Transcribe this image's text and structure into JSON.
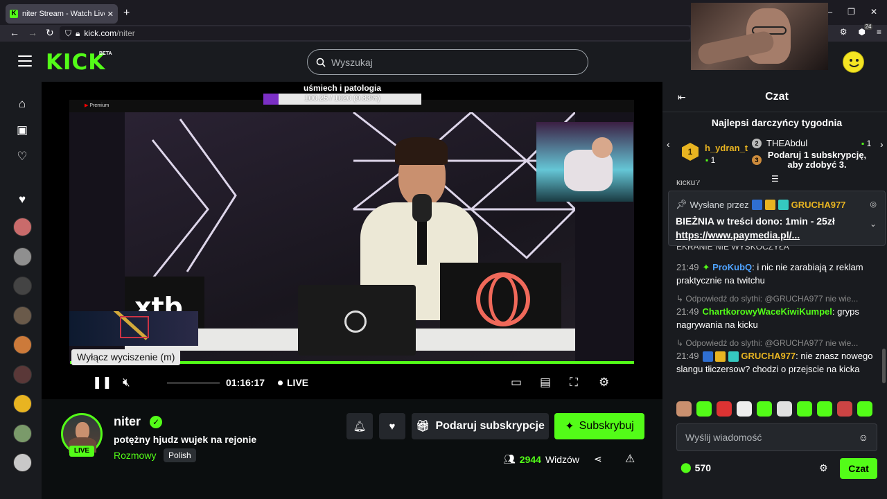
{
  "browser": {
    "tab_title": "niter Stream - Watch Live on Ki",
    "tab_close": "✕",
    "new_tab": "+",
    "url_host": "kick.com",
    "url_path": "/niter",
    "ext_badge": "24"
  },
  "header": {
    "logo": "KICK",
    "beta": "BETA",
    "search_placeholder": "Wyszukaj"
  },
  "sidebar": {
    "nav": [
      "home-icon",
      "following-icon",
      "heart-icon"
    ],
    "avatars": [
      "#c96b6b",
      "#8f8f8f",
      "#444",
      "#6a5a4a",
      "#cc7a3a",
      "#5a3838",
      "#e8b421",
      "#7a9a6a",
      "#c8c8c8"
    ]
  },
  "player": {
    "overlay_title": "uśmiech i patologia",
    "overlay_progress_text": "100.25 / 1020 (9.83%)",
    "overlay_progress_pct": 9.83,
    "yt_label": "Premium",
    "xtb": "xtb",
    "progress_pct": 100,
    "time": "01:16:17",
    "live_label": "LIVE",
    "tooltip": "Wyłącz wyciszenie (m)"
  },
  "channel": {
    "name": "niter",
    "live_badge": "LIVE",
    "title": "potężny hjudz wujek na rejonie",
    "category": "Rozmowy",
    "language_tag": "Polish",
    "gift_label": "Podaruj subskrypcje",
    "subscribe_label": "Subskrybuj",
    "viewers": "2944",
    "viewers_label": "Widzów"
  },
  "chat": {
    "title": "Czat",
    "gifters_title": "Najlepsi darczyńcy tygodnia",
    "gifter1": {
      "rank": "1",
      "name": "h_ydran_t",
      "count": "1"
    },
    "gifter2": {
      "rank": "2",
      "name": "THEAbdul",
      "count": "1"
    },
    "gifter3": {
      "rank": "3",
      "text": "Podaruj 1 subskrypcję, aby zdobyć 3."
    },
    "clipped_top": "kicku?",
    "pinned": {
      "by_label": "Wysłane przez",
      "user": "GRUCHA977",
      "line1": "BIEŻNIA w treści dono: 1min - 25zł",
      "line2": "https://www.paymedia.pl/..."
    },
    "clipped_under": "EKRANIE NIE WYSKOCZYŁA",
    "messages": [
      {
        "time": "21:49",
        "user": "ProKubQ",
        "color": "#4fa3ff",
        "text": "i nic nie zarabiają z reklam praktycznie na twitchu"
      },
      {
        "reply": "Odpowiedź do slythi: @GRUCHA977 nie wie...",
        "time": "21:49",
        "user": "ChartkorowyWaceKiwiKumpel",
        "color": "#53fc18",
        "text": "gryps nagrywania na kicku"
      },
      {
        "reply": "Odpowiedź do slythi: @GRUCHA977 nie wie...",
        "time": "21:49",
        "user": "GRUCHA977",
        "color": "#e8b421",
        "text": "nie znasz nowego slangu tłiczersow? chodzi o przejscie na kicka"
      }
    ],
    "input_placeholder": "Wyślij wiadomość",
    "points": "570",
    "send_label": "Czat"
  }
}
